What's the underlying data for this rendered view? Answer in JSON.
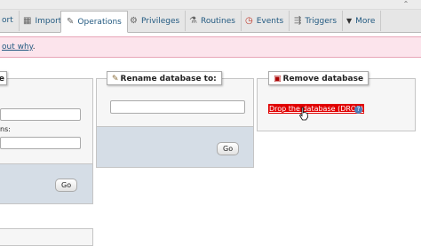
{
  "tabs": [
    {
      "label": "ort",
      "icon": "export-icon"
    },
    {
      "label": "Import",
      "icon": "import-icon"
    },
    {
      "label": "Operations",
      "icon": "wrench-icon",
      "active": true
    },
    {
      "label": "Privileges",
      "icon": "privileges-icon"
    },
    {
      "label": "Routines",
      "icon": "routines-icon"
    },
    {
      "label": "Events",
      "icon": "clock-icon"
    },
    {
      "label": "Triggers",
      "icon": "triggers-icon"
    },
    {
      "label": "More",
      "icon": "chevron-down-icon"
    }
  ],
  "notice": {
    "link_text": "out why",
    "punct": "."
  },
  "left_panel": {
    "legend": "e",
    "field_label": "ns:",
    "go_label": "Go"
  },
  "rename_panel": {
    "legend": "Rename database to:",
    "input_value": "",
    "go_label": "Go"
  },
  "remove_panel": {
    "legend": "Remove database",
    "drop_link": "Drop the database (DROP)"
  },
  "colors": {
    "active_tab_bg": "#ffffff",
    "notice_bg": "#fce4ec",
    "drop_link_bg": "#e00000",
    "link": "#235a81"
  }
}
